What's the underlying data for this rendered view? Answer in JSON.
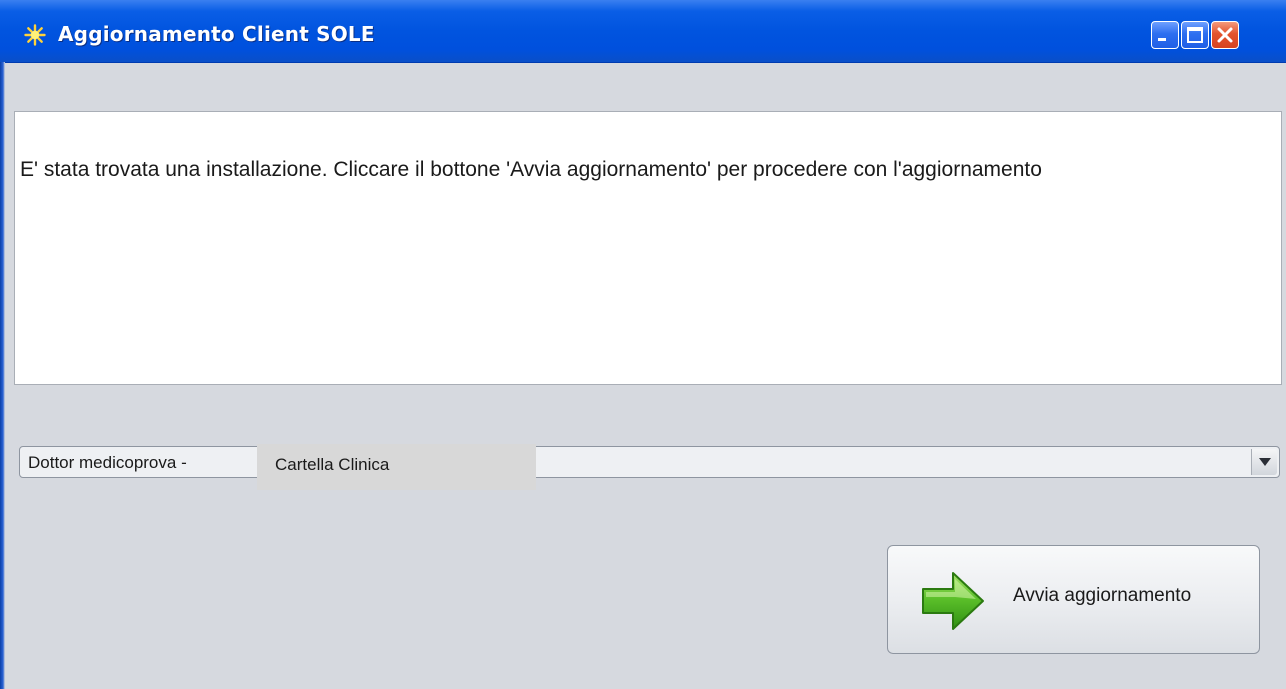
{
  "window": {
    "title": "Aggiornamento Client SOLE",
    "controls": {
      "minimize_icon": "minimize-icon",
      "maximize_icon": "maximize-icon",
      "close_icon": "close-icon"
    },
    "title_color": "#0054e3"
  },
  "message": {
    "text": "E' stata trovata una installazione. Cliccare il bottone 'Avvia aggiornamento' per procedere con l'aggiornamento"
  },
  "selector": {
    "prefix": "Dottor medicoprova -",
    "highlight": "Cartella Clinica",
    "arrow_icon": "dropdown-arrow-icon"
  },
  "actions": {
    "start_update_label": "Avvia aggiornamento",
    "start_update_icon": "green-arrow-right-icon"
  }
}
